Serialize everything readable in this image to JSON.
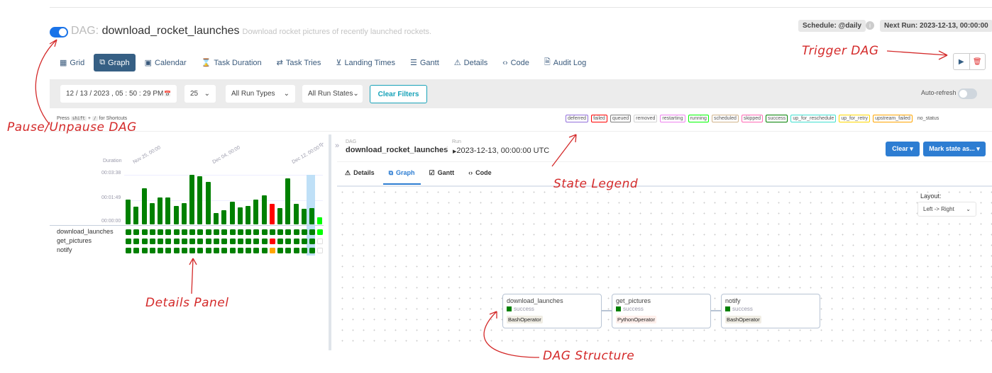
{
  "header": {
    "prefix": "DAG:",
    "dag_id": "download_rocket_launches",
    "description": "Download rocket pictures of recently launched rockets.",
    "schedule": "Schedule: @daily",
    "next_run": "Next Run: 2023-12-13, 00:00:00",
    "info_icon": "i"
  },
  "nav": [
    {
      "label": "Grid",
      "icon": "grid-icon",
      "glyph": "▦"
    },
    {
      "label": "Graph",
      "icon": "graph-icon",
      "glyph": "⧉",
      "active": true
    },
    {
      "label": "Calendar",
      "icon": "calendar-icon",
      "glyph": "▣"
    },
    {
      "label": "Task Duration",
      "icon": "hourglass-icon",
      "glyph": "⌛"
    },
    {
      "label": "Task Tries",
      "icon": "repeat-icon",
      "glyph": "⇄"
    },
    {
      "label": "Landing Times",
      "icon": "plane-landing-icon",
      "glyph": "⊻"
    },
    {
      "label": "Gantt",
      "icon": "gantt-icon",
      "glyph": "☰"
    },
    {
      "label": "Details",
      "icon": "warning-triangle-icon",
      "glyph": "⚠"
    },
    {
      "label": "Code",
      "icon": "code-icon",
      "glyph": "‹›"
    },
    {
      "label": "Audit Log",
      "icon": "file-icon",
      "glyph": "🗎"
    }
  ],
  "actions": {
    "trigger_glyph": "▶",
    "delete_glyph": "🗑"
  },
  "filters": {
    "date": "12 / 13 / 2023 ,  05 : 50 : 29   PM",
    "calendar_glyph": "📅",
    "num_runs": "25",
    "run_types": "All Run Types",
    "run_states": "All Run States",
    "chevron": "⌄",
    "clear": "Clear Filters",
    "auto_refresh": "Auto-refresh"
  },
  "shortcuts": {
    "press": "Press",
    "key1": "shift",
    "plus": "+",
    "key2": "/",
    "tail": "for Shortcuts"
  },
  "legend": [
    {
      "label": "deferred",
      "color": "#9370db"
    },
    {
      "label": "failed",
      "color": "#ff0000"
    },
    {
      "label": "queued",
      "color": "#808080"
    },
    {
      "label": "removed",
      "color": "#d3d3d3"
    },
    {
      "label": "restarting",
      "color": "#ee82ee"
    },
    {
      "label": "running",
      "color": "#00ff00"
    },
    {
      "label": "scheduled",
      "color": "#d2b48c"
    },
    {
      "label": "skipped",
      "color": "#ff69b4"
    },
    {
      "label": "success",
      "color": "#008000"
    },
    {
      "label": "up_for_reschedule",
      "color": "#40e0d0"
    },
    {
      "label": "up_for_retry",
      "color": "#ffd700"
    },
    {
      "label": "upstream_failed",
      "color": "#ffa500"
    },
    {
      "label": "no_status",
      "color": ""
    }
  ],
  "grid": {
    "collapse": "«",
    "duration_label": "Duration",
    "y_ticks": [
      "00:03:38",
      "00:01:49",
      "00:00:00"
    ],
    "x_ticks": [
      "Nov 25, 00:00",
      "Dec 04, 00:00",
      "Dec 12, 00:00"
    ],
    "max_seconds": 218,
    "run_durations_seconds": [
      108,
      77,
      159,
      93,
      118,
      118,
      82,
      93,
      217,
      211,
      187,
      49,
      62,
      100,
      75,
      80,
      110,
      128,
      90,
      73,
      202,
      90,
      70,
      72,
      30
    ],
    "run_states": [
      "success",
      "success",
      "success",
      "success",
      "success",
      "success",
      "success",
      "success",
      "success",
      "success",
      "success",
      "success",
      "success",
      "success",
      "success",
      "success",
      "success",
      "success",
      "failed",
      "success",
      "success",
      "success",
      "success",
      "success",
      "running"
    ],
    "tasks": [
      {
        "name": "download_launches",
        "states": [
          "s",
          "s",
          "s",
          "s",
          "s",
          "s",
          "s",
          "s",
          "s",
          "s",
          "s",
          "s",
          "s",
          "s",
          "s",
          "s",
          "s",
          "s",
          "s",
          "s",
          "s",
          "s",
          "s",
          "s",
          "r"
        ]
      },
      {
        "name": "get_pictures",
        "states": [
          "s",
          "s",
          "s",
          "s",
          "s",
          "s",
          "s",
          "s",
          "s",
          "s",
          "s",
          "s",
          "s",
          "s",
          "s",
          "s",
          "s",
          "s",
          "f",
          "s",
          "s",
          "s",
          "s",
          "s",
          "n"
        ]
      },
      {
        "name": "notify",
        "states": [
          "s",
          "s",
          "s",
          "s",
          "s",
          "s",
          "s",
          "s",
          "s",
          "s",
          "s",
          "s",
          "s",
          "s",
          "s",
          "s",
          "s",
          "s",
          "u",
          "s",
          "s",
          "s",
          "s",
          "s",
          "n"
        ]
      }
    ],
    "selected_run_index": 23
  },
  "details": {
    "expand": "»",
    "dag_label": "DAG",
    "dag_id": "download_rocket_launches",
    "sep": "/",
    "run_label": "Run",
    "run_id": "2023-12-13, 00:00:00 UTC",
    "clear": "Clear ▾",
    "mark": "Mark state as... ▾",
    "tabs": [
      {
        "label": "Details",
        "glyph": "⚠"
      },
      {
        "label": "Graph",
        "glyph": "⧉",
        "active": true
      },
      {
        "label": "Gantt",
        "glyph": "☑"
      },
      {
        "label": "Code",
        "glyph": "‹›"
      }
    ],
    "layout_label": "Layout:",
    "layout_value": "Left -> Right"
  },
  "graph_nodes": [
    {
      "name": "download_launches",
      "state": "success",
      "operator": "BashOperator",
      "op_color": "#f0ede4"
    },
    {
      "name": "get_pictures",
      "state": "success",
      "operator": "PythonOperator",
      "op_color": "#ffefeb"
    },
    {
      "name": "notify",
      "state": "success",
      "operator": "BashOperator",
      "op_color": "#f0ede4"
    }
  ],
  "annotations": {
    "pause": "Pause/Unpause DAG",
    "trigger": "Trigger DAG",
    "legend": "State Legend",
    "details": "Details Panel",
    "structure": "DAG Structure"
  },
  "colors": {
    "success": "#008000",
    "failed": "#ff0000",
    "running": "#00ff00",
    "upstream_failed": "#ffa500",
    "accent": "#2d7dd2",
    "annotation": "#d42a2a"
  }
}
